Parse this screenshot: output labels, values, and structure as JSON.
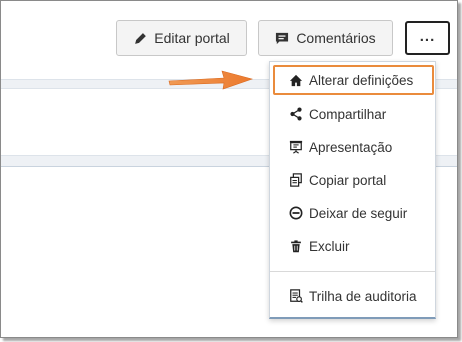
{
  "toolbar": {
    "edit_label": "Editar portal",
    "comments_label": "Comentários",
    "more_label": "..."
  },
  "menu": {
    "items": [
      {
        "label": "Alterar definições",
        "icon": "home-icon"
      },
      {
        "label": "Compartilhar",
        "icon": "share-icon"
      },
      {
        "label": "Apresentação",
        "icon": "presentation-icon"
      },
      {
        "label": "Copiar portal",
        "icon": "copy-icon"
      },
      {
        "label": "Deixar de seguir",
        "icon": "unfollow-icon"
      },
      {
        "label": "Excluir",
        "icon": "trash-icon"
      },
      {
        "label": "Trilha de auditoria",
        "icon": "audit-icon"
      }
    ]
  },
  "colors": {
    "highlight": "#ea8b3c",
    "arrow": "#ee7d33",
    "button_bg": "#f4f4f4",
    "strip": "#eef1f5"
  }
}
